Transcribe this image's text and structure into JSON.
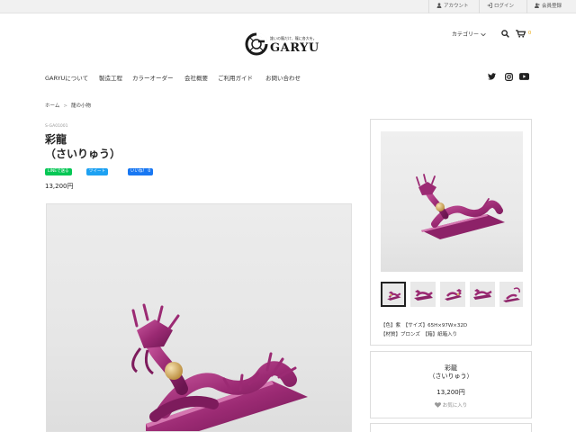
{
  "topbar": {
    "account": "アカウント",
    "login": "ログイン",
    "signup": "会員登録"
  },
  "logo": {
    "tagline": "誰いの龍だけ、龍に各大を。",
    "wordmark": "GARYU"
  },
  "header": {
    "category": "カテゴリー",
    "cart_count": "0"
  },
  "nav": {
    "items": [
      "GARYUについて",
      "製造工程",
      "カラーオーダー",
      "会社概要",
      "ご利用ガイド",
      "お問い合わせ"
    ]
  },
  "breadcrumb": {
    "home": "ホーム",
    "current": "龍の小物"
  },
  "product": {
    "sku": "S-GA01001",
    "title_line1": "彩龍",
    "title_line2": "（さいりゅう）",
    "price": "13,200円",
    "share": {
      "line": "LINEで送る",
      "tweet": "ツイート",
      "like": "いいね！ 0"
    }
  },
  "sidebar": {
    "spec_line1": "【色】紫　【サイズ】65H×97W×32D",
    "spec_line2": "【材質】ブロンズ　【箱】紙箱入り",
    "name_line1": "彩龍",
    "name_line2": "（さいりゅう）",
    "price": "13,200円",
    "favorite": "お気に入り"
  },
  "colors": {
    "line": "#06c755",
    "twitter": "#1da1f2",
    "facebook": "#1877f2",
    "dragon": "#9b2a73",
    "dragon_light": "#c9579e",
    "pearl": "#d8b063",
    "cart": "#e8a400"
  }
}
